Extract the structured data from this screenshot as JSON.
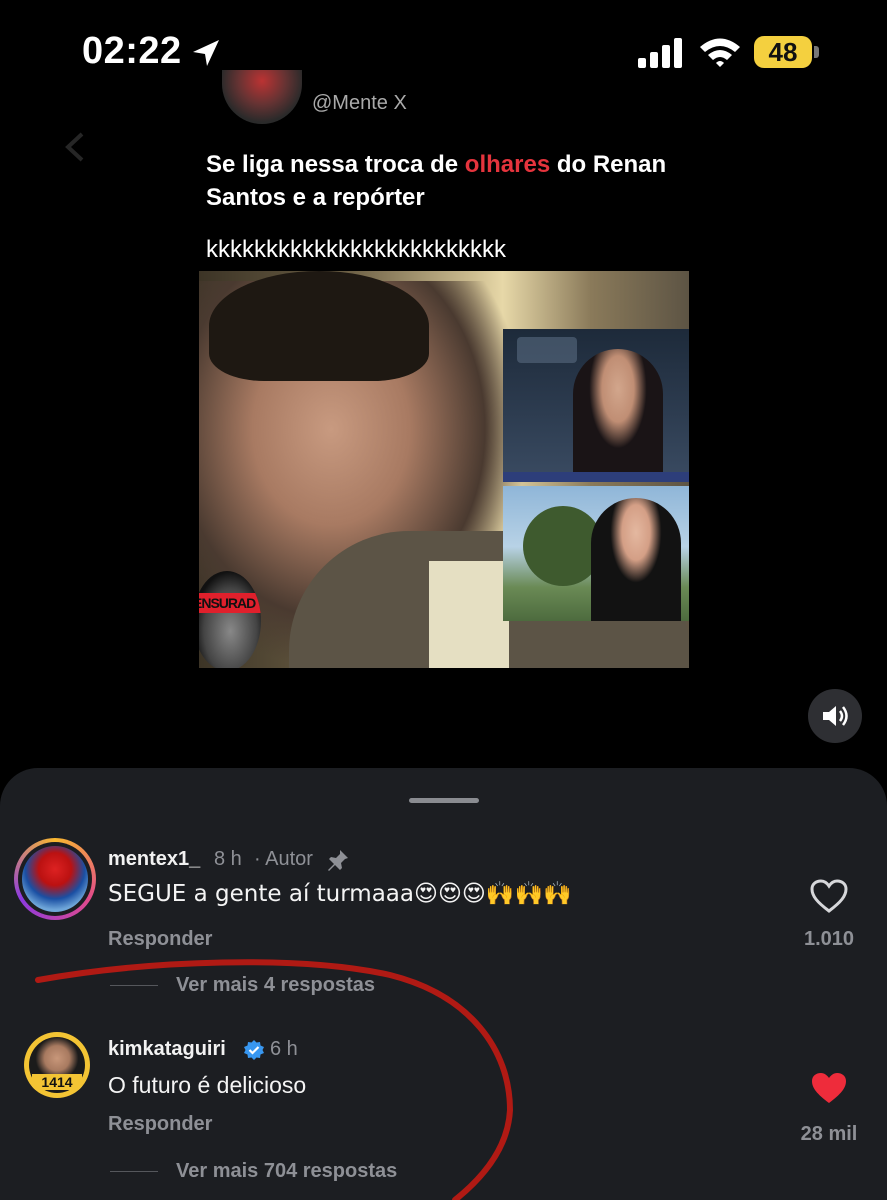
{
  "status_bar": {
    "time": "02:22",
    "battery": "48"
  },
  "post": {
    "handle": "@Mente X",
    "text_before": "Se liga nessa troca de ",
    "text_highlight": "olhares",
    "text_after": " do Renan Santos e a repórter",
    "subtext": "kkkkkkkkkkkkkkkkkkkkkkkkk",
    "badge_text": "ENSURAD",
    "highlight_color": "#e5343d"
  },
  "comments": [
    {
      "username": "mentex1_",
      "time": "8 h",
      "author_tag": "· Autor",
      "text": "SEGUE a gente aí turmaaa😍😍😍🙌🙌🙌",
      "reply_label": "Responder",
      "likes": "1.010",
      "liked": false,
      "more_replies": "Ver mais 4 respostas",
      "avatar_icon": "spiderman-avatar"
    },
    {
      "username": "kimkataguiri",
      "time": "6 h",
      "text": "O futuro é delicioso",
      "reply_label": "Responder",
      "likes": "28 mil",
      "liked": true,
      "more_replies": "Ver mais 704 respostas",
      "avatar_number": "1414"
    }
  ],
  "colors": {
    "sheet_bg": "#1c1e22",
    "like_red": "#ee2c3b",
    "verified_blue": "#3897f0",
    "annotation_red": "#b01a14"
  }
}
